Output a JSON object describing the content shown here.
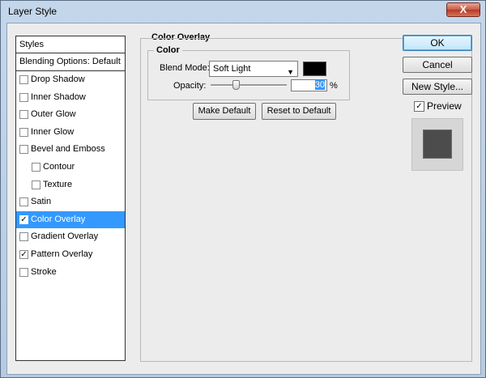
{
  "window": {
    "title": "Layer Style",
    "close_glyph": "X"
  },
  "styles_panel": {
    "header": "Styles",
    "blending_options": "Blending Options: Default",
    "items": [
      {
        "label": "Drop Shadow",
        "checked": false,
        "indent": false,
        "selected": false
      },
      {
        "label": "Inner Shadow",
        "checked": false,
        "indent": false,
        "selected": false
      },
      {
        "label": "Outer Glow",
        "checked": false,
        "indent": false,
        "selected": false
      },
      {
        "label": "Inner Glow",
        "checked": false,
        "indent": false,
        "selected": false
      },
      {
        "label": "Bevel and Emboss",
        "checked": false,
        "indent": false,
        "selected": false
      },
      {
        "label": "Contour",
        "checked": false,
        "indent": true,
        "selected": false
      },
      {
        "label": "Texture",
        "checked": false,
        "indent": true,
        "selected": false
      },
      {
        "label": "Satin",
        "checked": false,
        "indent": false,
        "selected": false
      },
      {
        "label": "Color Overlay",
        "checked": true,
        "indent": false,
        "selected": true
      },
      {
        "label": "Gradient Overlay",
        "checked": false,
        "indent": false,
        "selected": false
      },
      {
        "label": "Pattern Overlay",
        "checked": true,
        "indent": false,
        "selected": false
      },
      {
        "label": "Stroke",
        "checked": false,
        "indent": false,
        "selected": false
      }
    ]
  },
  "color_overlay": {
    "section_title": "Color Overlay",
    "group_title": "Color",
    "blend_mode_label": "Blend Mode:",
    "blend_mode_value": "Soft Light",
    "overlay_color": "#000000",
    "opacity_label": "Opacity:",
    "opacity_value": "30",
    "opacity_unit": "%",
    "make_default": "Make Default",
    "reset_default": "Reset to Default"
  },
  "actions": {
    "ok": "OK",
    "cancel": "Cancel",
    "new_style": "New Style...",
    "preview_label": "Preview",
    "preview_checked": true
  }
}
